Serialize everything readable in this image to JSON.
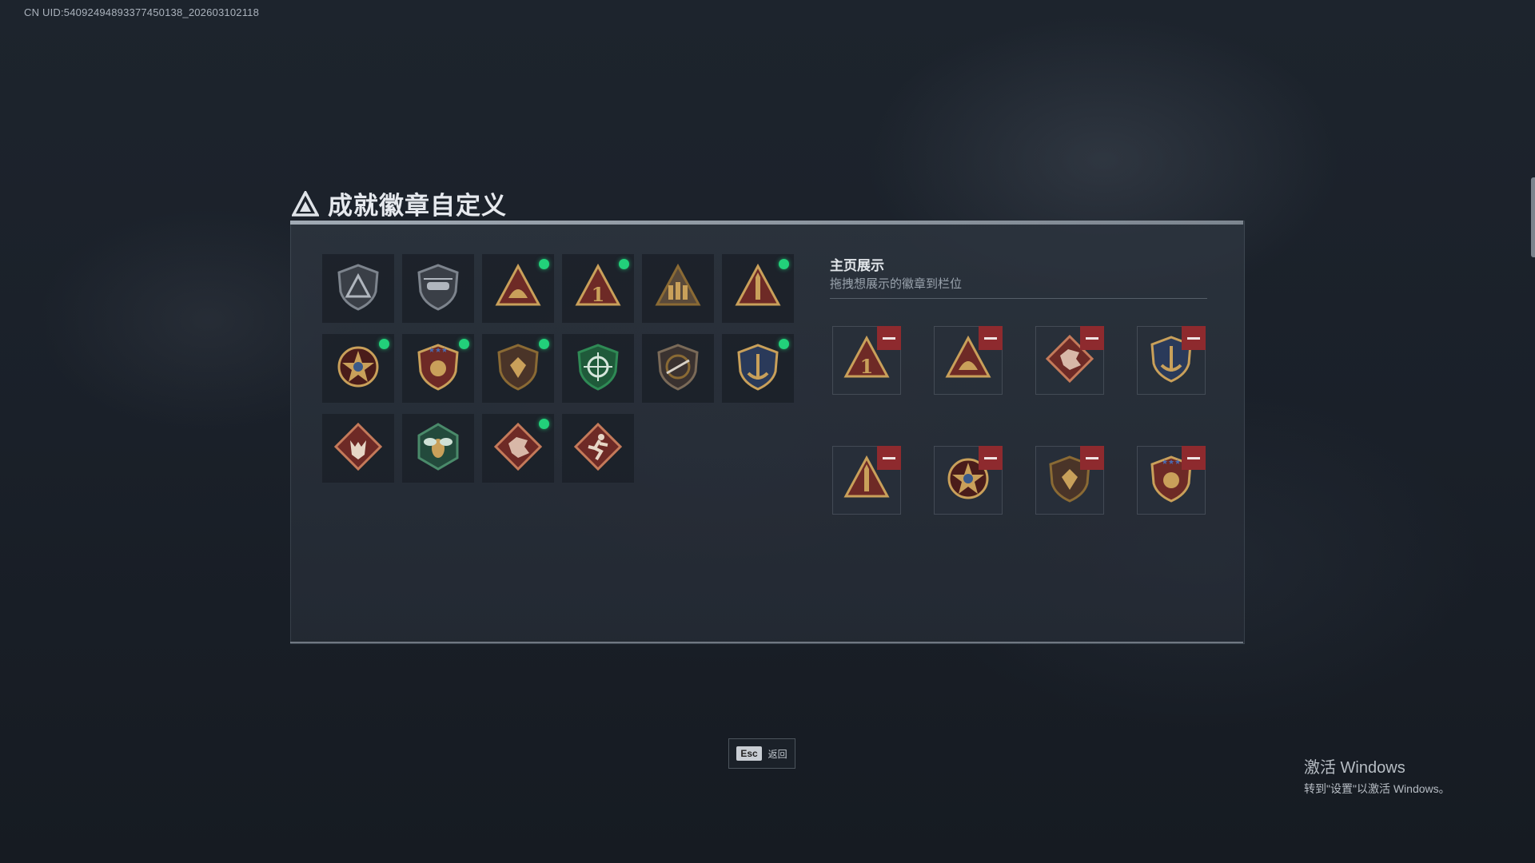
{
  "header": {
    "uid_text": "CN UID:54092494893377450138_202603102118"
  },
  "page": {
    "title": "成就徽章自定义"
  },
  "badge_library": [
    {
      "icon": "shield-triangle-badge",
      "equipped": false
    },
    {
      "icon": "helicopter-shield-badge",
      "equipped": false
    },
    {
      "icon": "triangle-helmet-badge",
      "equipped": true
    },
    {
      "icon": "triangle-number-one-badge",
      "equipped": true
    },
    {
      "icon": "triangle-soldiers-badge",
      "equipped": false
    },
    {
      "icon": "triangle-missile-badge",
      "equipped": true
    },
    {
      "icon": "star-compass-badge",
      "equipped": true
    },
    {
      "icon": "stars-crest-badge",
      "equipped": true
    },
    {
      "icon": "gem-shield-badge",
      "equipped": true
    },
    {
      "icon": "green-crosshair-shield-badge",
      "equipped": false
    },
    {
      "icon": "rifle-shield-badge",
      "equipped": false
    },
    {
      "icon": "anchor-laurel-badge",
      "equipped": true
    },
    {
      "icon": "wolf-diamond-badge",
      "equipped": false
    },
    {
      "icon": "wasp-hexagon-badge",
      "equipped": false
    },
    {
      "icon": "dragon-diamond-badge",
      "equipped": true
    },
    {
      "icon": "runner-diamond-badge",
      "equipped": false
    }
  ],
  "showcase": {
    "title": "主页展示",
    "subtitle": "拖拽想展示的徽章到栏位",
    "slots": [
      {
        "icon": "triangle-number-one-badge"
      },
      {
        "icon": "triangle-helmet-badge"
      },
      {
        "icon": "dragon-diamond-badge"
      },
      {
        "icon": "anchor-laurel-badge"
      },
      {
        "icon": "triangle-missile-badge"
      },
      {
        "icon": "star-compass-badge"
      },
      {
        "icon": "gem-shield-badge"
      },
      {
        "icon": "stars-crest-badge"
      }
    ]
  },
  "footer": {
    "esc_key": "Esc",
    "esc_label": "返回"
  },
  "watermark": {
    "line1": "激活 Windows",
    "line2": "转到\"设置\"以激活 Windows。"
  },
  "colors": {
    "equipped_dot": "#22d07a",
    "remove_button": "#8e2a2e",
    "gold": "#c9a05a",
    "maroon": "#6e2a26"
  }
}
